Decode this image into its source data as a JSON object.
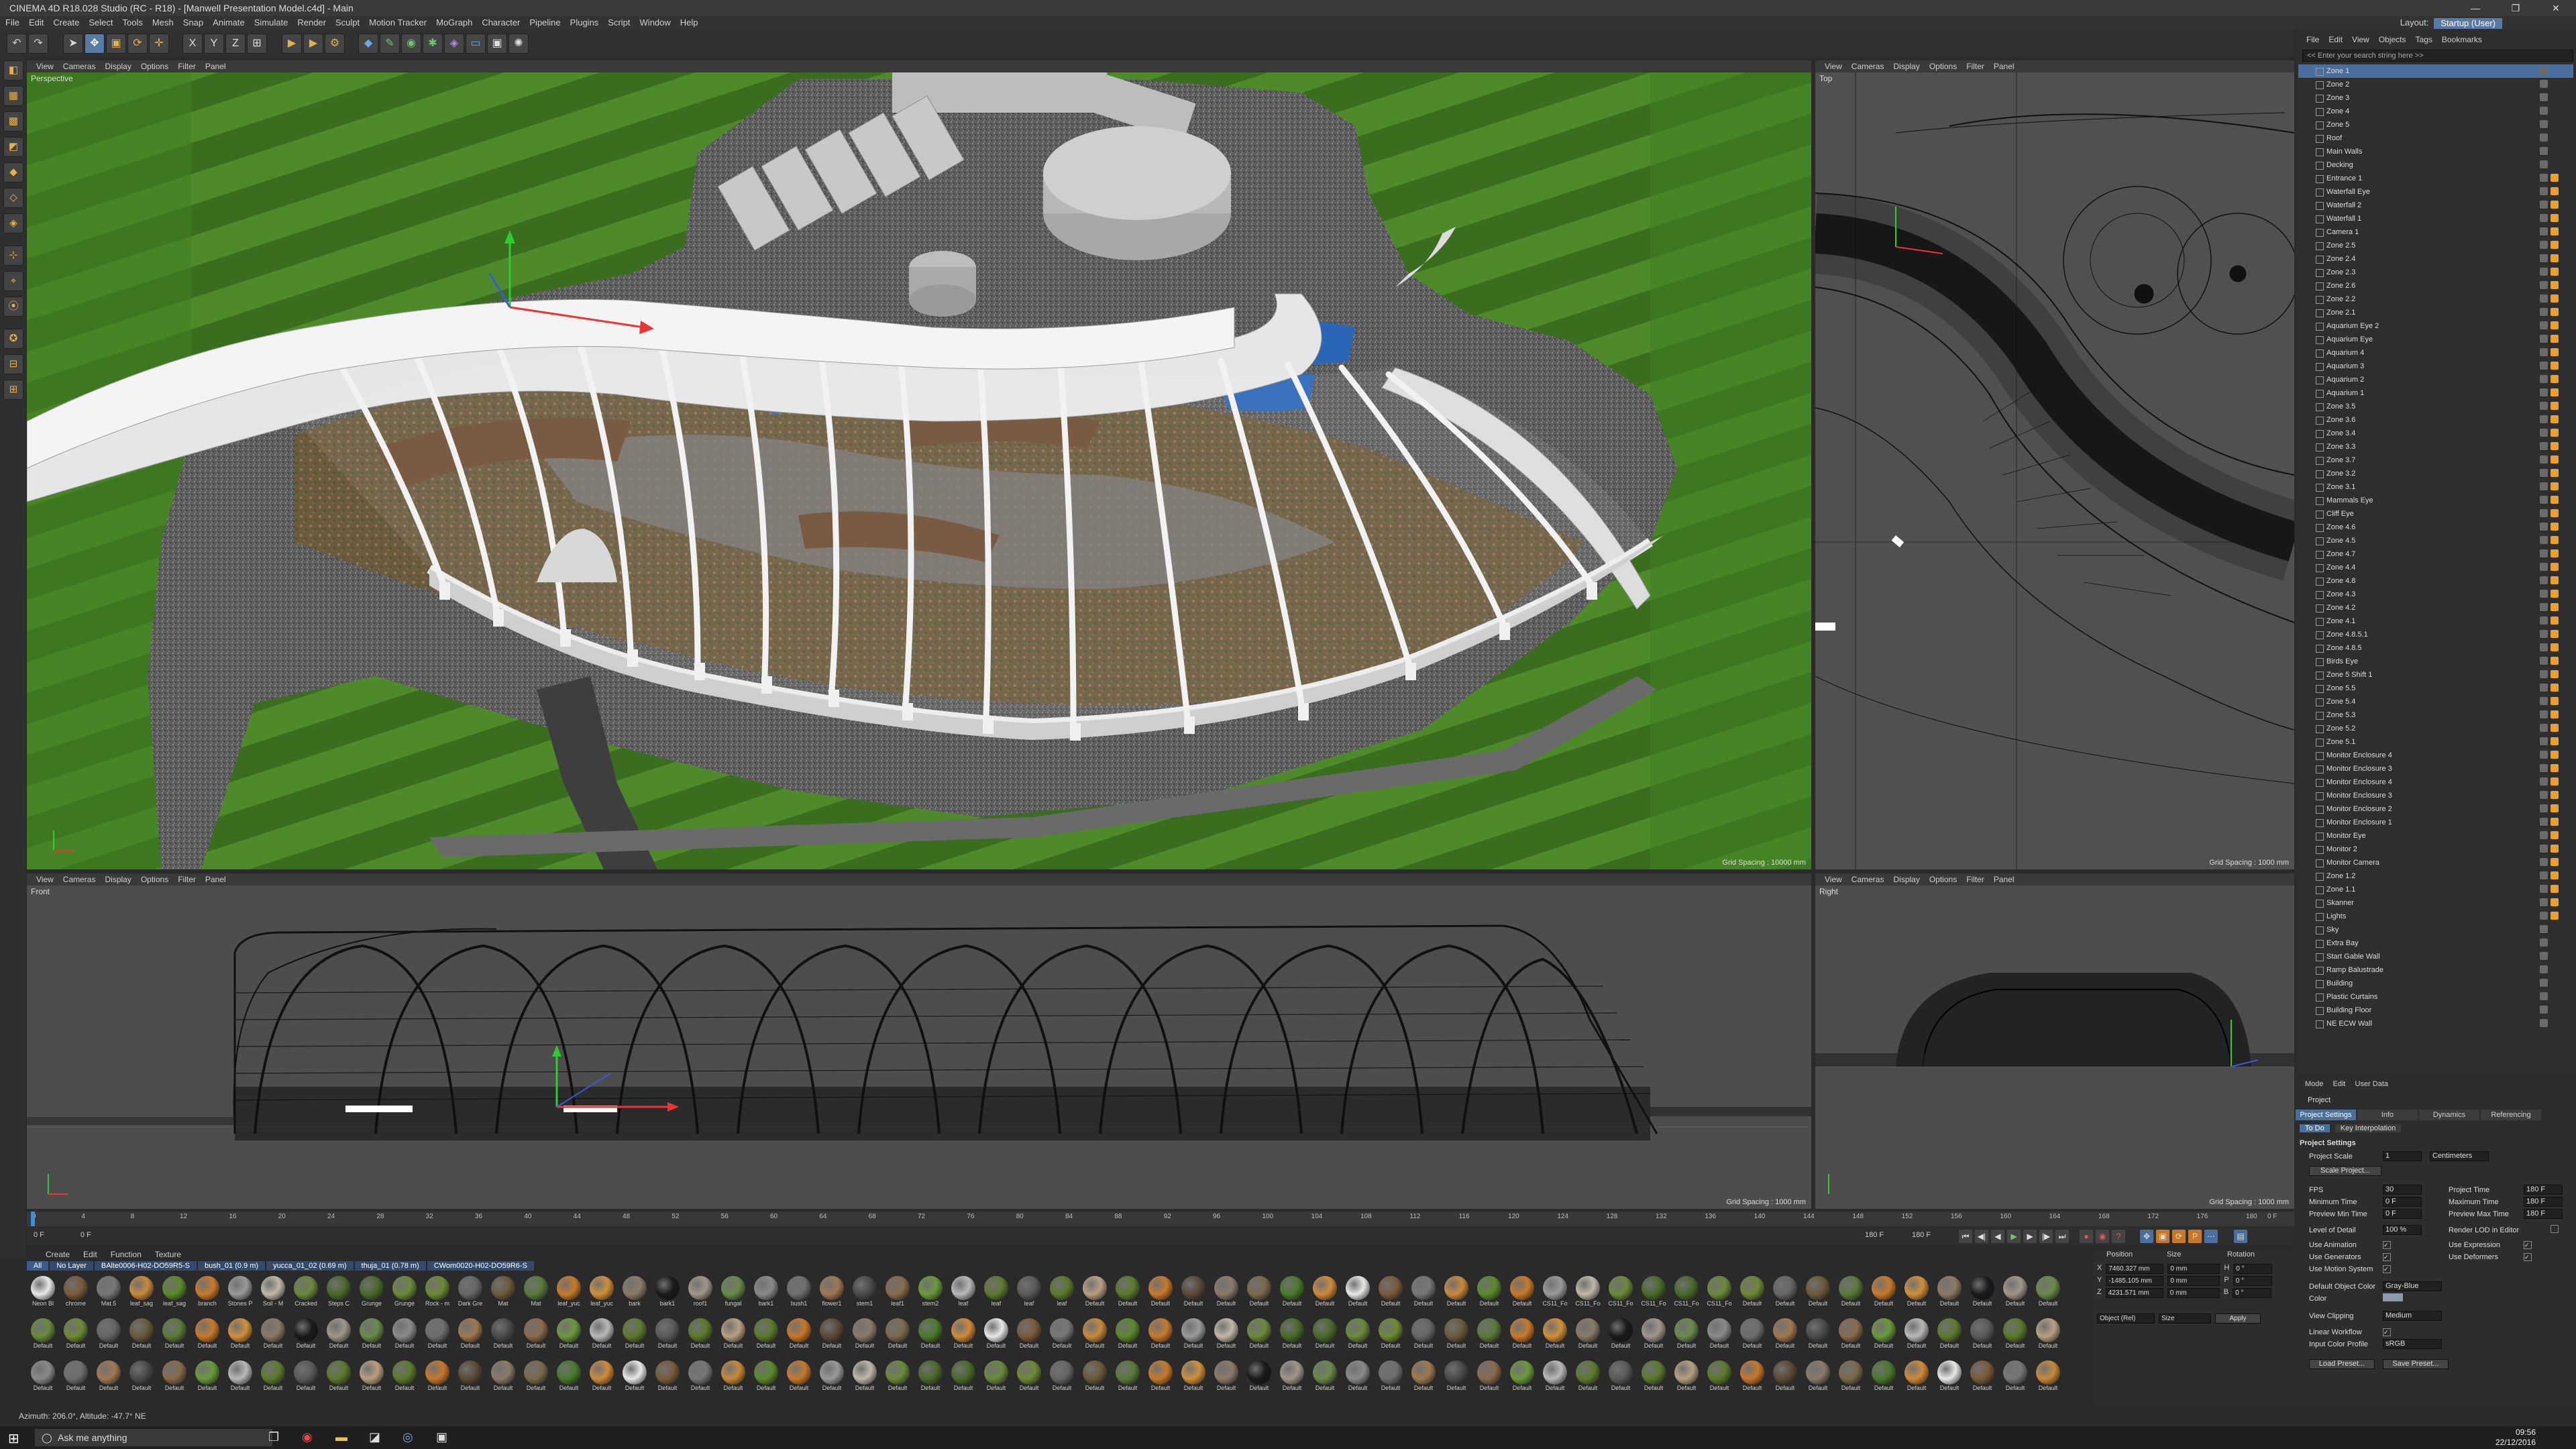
{
  "window": {
    "title": "CINEMA 4D R18.028 Studio (RC - R18) - [Manwell Presentation Model.c4d] - Main",
    "min": "—",
    "max": "❐",
    "close": "✕"
  },
  "menu": [
    "File",
    "Edit",
    "Create",
    "Select",
    "Tools",
    "Mesh",
    "Snap",
    "Animate",
    "Simulate",
    "Render",
    "Sculpt",
    "Motion Tracker",
    "MoGraph",
    "Character",
    "Pipeline",
    "Plugins",
    "Script",
    "Window",
    "Help"
  ],
  "layout": {
    "label": "Layout:",
    "value": "Startup (User)"
  },
  "viewport_menu": [
    "View",
    "Cameras",
    "Display",
    "Options",
    "Filter",
    "Panel"
  ],
  "viewports": {
    "perspective": {
      "label": "Perspective",
      "grid": "Grid Spacing : 10000 mm"
    },
    "top": {
      "label": "Top",
      "grid": "Grid Spacing : 1000 mm"
    },
    "front": {
      "label": "Front",
      "grid": "Grid Spacing : 1000 mm"
    },
    "right": {
      "label": "Right",
      "grid": "Grid Spacing : 1000 mm"
    }
  },
  "timeline": {
    "ticks": [
      "0",
      "4",
      "8",
      "12",
      "16",
      "20",
      "24",
      "28",
      "32",
      "36",
      "40",
      "44",
      "48",
      "52",
      "56",
      "60",
      "64",
      "68",
      "72",
      "76",
      "80",
      "84",
      "88",
      "92",
      "96",
      "100",
      "104",
      "108",
      "112",
      "116",
      "120",
      "124",
      "128",
      "132",
      "136",
      "140",
      "144",
      "148",
      "152",
      "156",
      "160",
      "164",
      "168",
      "172",
      "176",
      "180"
    ],
    "end_tick": "0 F",
    "current_frame": "0 F",
    "start_frame": "0 F",
    "max_frame": "180 F",
    "preview_max": "180 F"
  },
  "material_manager": {
    "menu": [
      "Create",
      "Edit",
      "Function",
      "Texture"
    ],
    "tabs": [
      "All",
      "No Layer",
      "BAlte0006-H02-DO59R5-S",
      "bush_01 (0.9 m)",
      "yucca_01_02 (0.69 m)",
      "thuja_01 (0.78 m)",
      "CWom0020-H02-DO59R6-S"
    ],
    "materials": [
      "Neon Bl",
      "chrome",
      "Mat.5",
      "leaf_sag",
      "leaf_sag",
      "branch",
      "Stones P",
      "Soil - M",
      "Cracked",
      "Steps C",
      "Grunge",
      "Grunge",
      "Rock - m",
      "Dark Gre",
      "Mat",
      "Mat",
      "leaf_yuc",
      "leaf_yuc",
      "bark",
      "bark1",
      "roof1",
      "fungal",
      "bark1",
      "bush1",
      "flower1",
      "stem1",
      "leaf1",
      "stem2",
      "leaf",
      "leaf",
      "leaf",
      "leaf",
      "Default",
      "Default",
      "Default",
      "Default",
      "Default",
      "Default",
      "Default",
      "Default",
      "Default",
      "Default",
      "Default",
      "Default",
      "Default",
      "Default",
      "CS11_Fo",
      "CS11_Fo",
      "CS11_Fo",
      "CS11_Fo",
      "CS11_Fo",
      "CS11_Fo",
      "Default",
      "Default",
      "Default",
      "Default",
      "Default",
      "Default",
      "Default",
      "Default",
      "Default",
      "Default",
      "Default",
      "Default",
      "Default",
      "Default",
      "Default",
      "Default",
      "Default",
      "Default",
      "Default",
      "Default",
      "Default",
      "Default",
      "Default",
      "Default",
      "Default",
      "Default",
      "Default",
      "Default",
      "Default",
      "Default",
      "Default",
      "Default",
      "Default",
      "Default",
      "Default",
      "Default",
      "Default",
      "Default",
      "Default",
      "Default",
      "Default",
      "Default",
      "Default",
      "Default",
      "Default",
      "Default",
      "Default",
      "Default",
      "Default",
      "Default",
      "Default",
      "Default",
      "Default",
      "Default",
      "Default",
      "Default",
      "Default",
      "Default",
      "Default",
      "Default",
      "Default",
      "Default",
      "Default",
      "Default",
      "Default",
      "Default",
      "Default",
      "Default",
      "Default",
      "Default",
      "Default",
      "Default",
      "Default",
      "Default",
      "Default",
      "Default",
      "Default",
      "Default",
      "Default",
      "Default",
      "Default",
      "Default",
      "Default",
      "Default",
      "Default",
      "Default",
      "Default",
      "Default",
      "Default",
      "Default",
      "Default",
      "Default",
      "Default",
      "Default",
      "Default",
      "Default",
      "Default",
      "Default",
      "Default",
      "Default",
      "Default",
      "Default",
      "Default",
      "Default",
      "Default",
      "Default",
      "Default",
      "Default",
      "Default",
      "Default",
      "Default",
      "Default",
      "Default",
      "Default",
      "Default",
      "Default",
      "Default",
      "Default",
      "Default",
      "Default",
      "Default",
      "Default",
      "Default",
      "Default",
      "Default",
      "Default",
      "Default",
      "Default",
      "Default",
      "Default",
      "Default",
      "Default",
      "Default",
      "Default",
      "Default",
      "Default"
    ],
    "colors": [
      "#e8e8e8",
      "#6e6e6e",
      "#9a9a9a",
      "#5d7a2e",
      "#6d8a34",
      "#5a4a36",
      "#8a7a66",
      "#7a5a3a",
      "#a07850",
      "#c0b8a8",
      "#5a5a5a",
      "#666666",
      "#8a7a6a",
      "#1a1a1a",
      "#777777",
      "#4a4a4a",
      "#6a8a3a",
      "#5a7a2a",
      "#6a5a3a",
      "#7a6a4a",
      "#a0968a",
      "#c88a3a",
      "#8a6a4a",
      "#4a6a2a",
      "#b8a080",
      "#5a7a3a",
      "#4a7a2a",
      "#6a8a4a",
      "#5a8a2a",
      "#6a9a3a",
      "#4a6a2a",
      "#5a7a2a",
      "#c87a2a",
      "#d08a3a",
      "#8a8a8a",
      "#c87a2a",
      "#b8b8b8",
      "#6a8a3a",
      "#c8782a",
      "#d0903a"
    ]
  },
  "coordinates": {
    "headers": [
      "Position",
      "Size",
      "Rotation"
    ],
    "rows": [
      {
        "axis": "X",
        "pos": "7460.327 mm",
        "size": "0 mm",
        "rot_label": "H",
        "rot": "0 °"
      },
      {
        "axis": "Y",
        "pos": "-1485.105 mm",
        "size": "0 mm",
        "rot_label": "P",
        "rot": "0 °"
      },
      {
        "axis": "Z",
        "pos": "4231.571 mm",
        "size": "0 mm",
        "rot_label": "B",
        "rot": "0 °"
      }
    ],
    "mode": "Object (Rel)",
    "size_mode": "Size",
    "apply": "Apply"
  },
  "object_manager": {
    "menu": [
      "File",
      "Edit",
      "View",
      "Objects",
      "Tags",
      "Bookmarks"
    ],
    "search": "<< Enter your search string here >>",
    "objects": [
      "Zone 1",
      "Zone 2",
      "Zone 3",
      "Zone 4",
      "Zone 5",
      "Roof",
      "Main Walls",
      "Decking",
      "Entrance 1",
      "Waterfall Eye",
      "Waterfall 2",
      "Waterfall 1",
      "Camera 1",
      "Zone 2.5",
      "Zone 2.4",
      "Zone 2.3",
      "Zone 2.6",
      "Zone 2.2",
      "Zone 2.1",
      "Aquarium Eye 2",
      "Aquarium Eye",
      "Aquarium 4",
      "Aquarium 3",
      "Aquarium 2",
      "Aquarium 1",
      "Zone 3.5",
      "Zone 3.6",
      "Zone 3.4",
      "Zone 3.3",
      "Zone 3.7",
      "Zone 3.2",
      "Zone 3.1",
      "Mammals Eye",
      "Cliff Eye",
      "Zone 4.6",
      "Zone 4.5",
      "Zone 4.7",
      "Zone 4.4",
      "Zone 4.8",
      "Zone 4.3",
      "Zone 4.2",
      "Zone 4.1",
      "Zone 4.8.5.1",
      "Zone 4.8.5",
      "Birds Eye",
      "Zone 5 Shift 1",
      "Zone 5.5",
      "Zone 5.4",
      "Zone 5.3",
      "Zone 5.2",
      "Zone 5.1",
      "Monitor Enclosure 4",
      "Monitor Enclosure 3",
      "Monitor Enclosure 4",
      "Monitor Enclosure 3",
      "Monitor Enclosure 2",
      "Monitor Enclosure 1",
      "Monitor Eye",
      "Monitor 2",
      "Monitor Camera",
      "Zone 1.2",
      "Zone 1.1",
      "Skanner",
      "Lights",
      "Sky",
      "Extra Bay",
      "Start Gable Wall",
      "Ramp Balustrade",
      "Building",
      "Plastic Curtains",
      "Building Floor",
      "NE ECW Wall"
    ]
  },
  "attributes": {
    "menu": [
      "Mode",
      "Edit",
      "User Data"
    ],
    "title": "Project",
    "tabs": [
      "Project Settings",
      "Info",
      "Dynamics",
      "Referencing"
    ],
    "subtabs": [
      "To Do",
      "Key Interpolation"
    ],
    "section": "Project Settings",
    "scale_label": "Project Scale",
    "scale_value": "1",
    "scale_unit": "Centimeters",
    "scale_button": "Scale Project...",
    "fps_label": "FPS",
    "fps": "30",
    "project_time_label": "Project Time",
    "project_time": "180 F",
    "min_time_label": "Minimum Time",
    "min_time": "0 F",
    "max_time_label": "Maximum Time",
    "max_time": "180 F",
    "prev_min_label": "Preview Min Time",
    "prev_min": "0 F",
    "prev_max_label": "Preview Max Time",
    "prev_max": "180 F",
    "lod_label": "Level of Detail",
    "lod": "100 %",
    "render_lod_label": "Render LOD in Editor",
    "use_animation": "Use Animation",
    "use_expression": "Use Expression",
    "use_generators": "Use Generators",
    "use_deformers": "Use Deformers",
    "use_motion": "Use Motion System",
    "default_color_label": "Default Object Color",
    "default_color": "Gray-Blue",
    "color_label": "Color",
    "view_clipping_label": "View Clipping",
    "view_clipping": "Medium",
    "linear_workflow": "Linear Workflow",
    "input_color_label": "Input Color Profile",
    "input_color": "sRGB",
    "load_preset": "Load Preset...",
    "save_preset": "Save Preset..."
  },
  "status": {
    "text": "Azimuth: 206.0°, Altitude: -47.7°  NE"
  },
  "taskbar": {
    "search": "Ask me anything",
    "time": "09:56",
    "date": "22/12/2016"
  }
}
